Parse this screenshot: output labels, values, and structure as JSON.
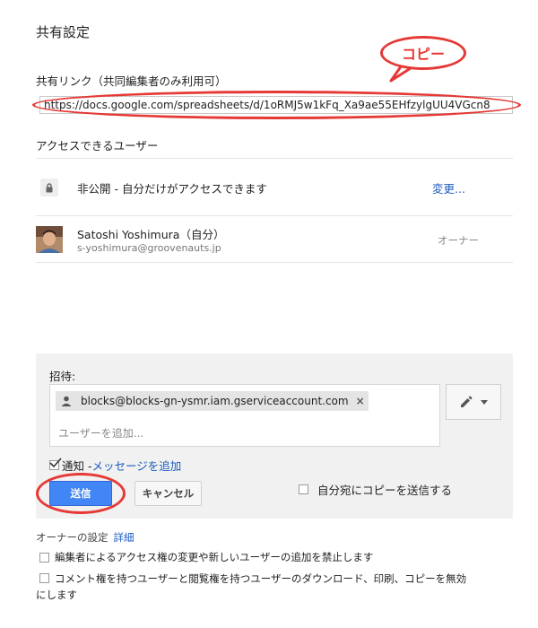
{
  "dialog": {
    "title": "共有設定"
  },
  "annotations": {
    "copy_callout": "コピー"
  },
  "share_link": {
    "label": "共有リンク（共同編集者のみ利用可）",
    "url": "https://docs.google.com/spreadsheets/d/1oRMJ5w1kFq_Xa9ae55EHfzylgUU4VGcn8"
  },
  "access": {
    "title": "アクセスできるユーザー",
    "visibility_text": "非公開 - 自分だけがアクセスできます",
    "change_link": "変更...",
    "users": [
      {
        "name": "Satoshi Yoshimura（自分）",
        "email": "s-yoshimura@groovenauts.jp",
        "role": "オーナー"
      }
    ]
  },
  "invite": {
    "label": "招待:",
    "chip_email": "blocks@blocks-gn-ysmr.iam.gserviceaccount.com",
    "chip_remove": "×",
    "add_user_placeholder": "ユーザーを追加...",
    "notify_label": "通知 - ",
    "add_message_link": "メッセージを追加",
    "notify_checked": true,
    "send_button": "送信",
    "cancel_button": "キャンセル",
    "copy_self_label": "自分宛にコピーを送信する",
    "copy_self_checked": false,
    "permission_icon": "pencil-icon"
  },
  "owner_settings": {
    "label": "オーナーの設定",
    "detail_link": "詳細",
    "options": [
      {
        "text": "編集者によるアクセス権の変更や新しいユーザーの追加を禁止します",
        "checked": false
      },
      {
        "text_line1": "コメント権を持つユーザーと閲覧権を持つユーザーのダウンロード、印刷、コピーを無効",
        "text_line2": "にします",
        "checked": false
      }
    ]
  },
  "colors": {
    "accent_blue": "#4285f4",
    "link_blue": "#1a5bbf",
    "annotation_red": "#e53935"
  }
}
